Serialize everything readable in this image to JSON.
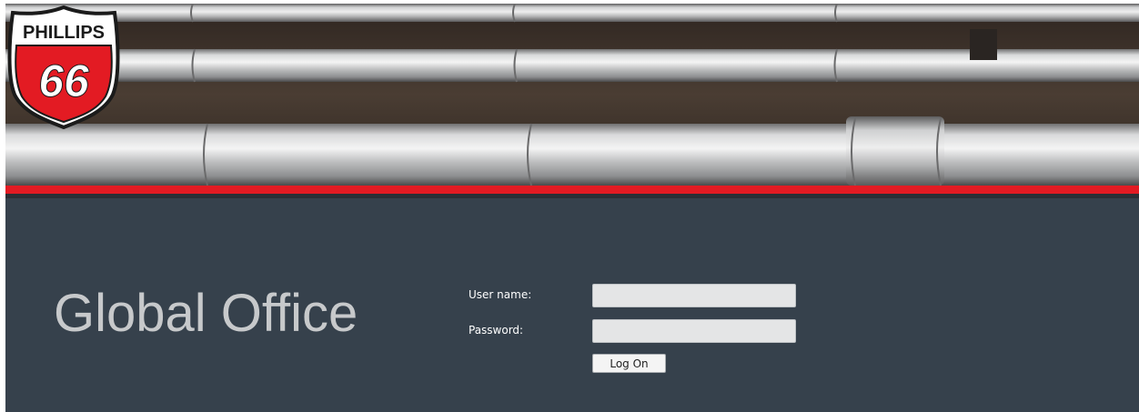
{
  "brand": {
    "logo_top_text": "PHILLIPS",
    "logo_number": "66",
    "colors": {
      "red": "#e31b23",
      "panel": "#36414c",
      "title": "#c7c9cb"
    }
  },
  "app": {
    "title": "Global Office"
  },
  "login": {
    "username_label": "User name:",
    "username_value": "",
    "password_label": "Password:",
    "password_value": "",
    "logon_label": "Log On"
  }
}
